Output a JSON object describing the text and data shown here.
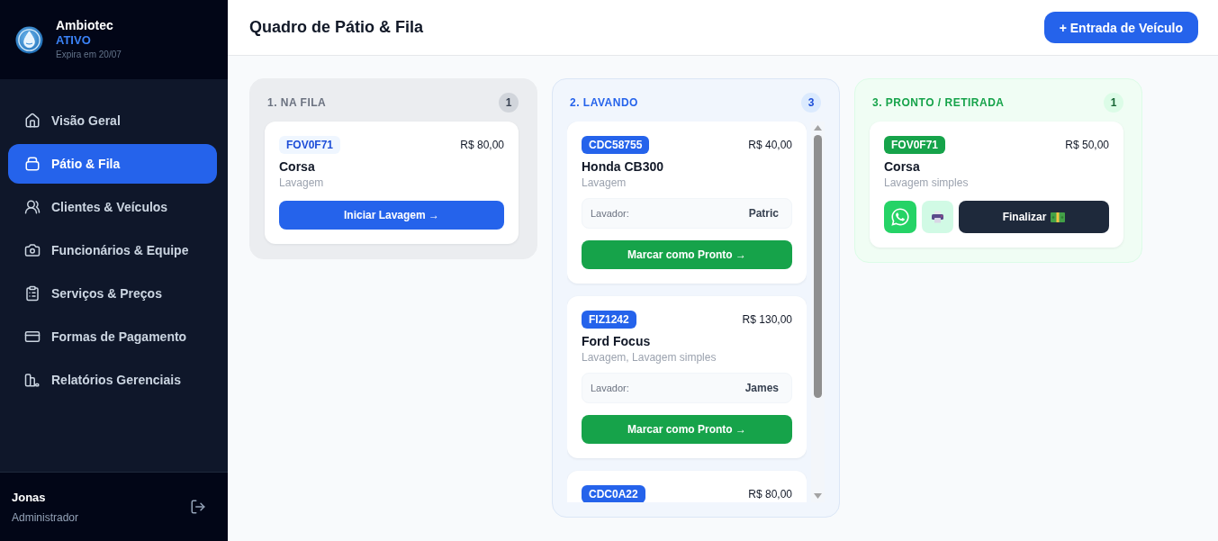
{
  "sidebar": {
    "brand": {
      "name": "Ambiotec",
      "status": "ATIVO",
      "expiry": "Expira em 20/07"
    },
    "nav": [
      {
        "label": "Visão Geral",
        "selected": false
      },
      {
        "label": "Pátio & Fila",
        "selected": true
      },
      {
        "label": "Clientes & Veículos",
        "selected": false
      },
      {
        "label": "Funcionários & Equipe",
        "selected": false
      },
      {
        "label": "Serviços & Preços",
        "selected": false
      },
      {
        "label": "Formas de Pagamento",
        "selected": false
      },
      {
        "label": "Relatórios Gerenciais",
        "selected": false
      }
    ],
    "user": {
      "name": "Jonas",
      "role": "Administrador"
    }
  },
  "header": {
    "title": "Quadro de Pátio & Fila",
    "button": "+ Entrada de Veículo"
  },
  "board": {
    "columns": [
      {
        "kind": "queue",
        "title": "1. NA FILA",
        "count": "1",
        "cards": [
          {
            "plate": "FOV0F71",
            "price": "R$ 80,00",
            "vehicle": "Corsa",
            "services": "Lavagem",
            "button": "Iniciar Lavagem →"
          }
        ]
      },
      {
        "kind": "washing",
        "title": "2. LAVANDO",
        "count": "3",
        "cards": [
          {
            "plate": "CDC58755",
            "price": "R$ 40,00",
            "vehicle": "Honda CB300",
            "services": "Lavagem",
            "washer_label": "Lavador:",
            "washer": "Patric",
            "button": "Marcar como Pronto →"
          },
          {
            "plate": "FIZ1242",
            "price": "R$ 130,00",
            "vehicle": "Ford Focus",
            "services": "Lavagem, Lavagem simples",
            "washer_label": "Lavador:",
            "washer": "James",
            "button": "Marcar como Pronto →"
          },
          {
            "plate": "CDC0A22",
            "price": "R$ 80,00"
          }
        ]
      },
      {
        "kind": "ready",
        "title": "3. PRONTO / RETIRADA",
        "count": "1",
        "cards": [
          {
            "plate": "FOV0F71",
            "price": "R$ 50,00",
            "vehicle": "Corsa",
            "services": "Lavagem simples",
            "button": "Finalizar"
          }
        ]
      }
    ]
  }
}
